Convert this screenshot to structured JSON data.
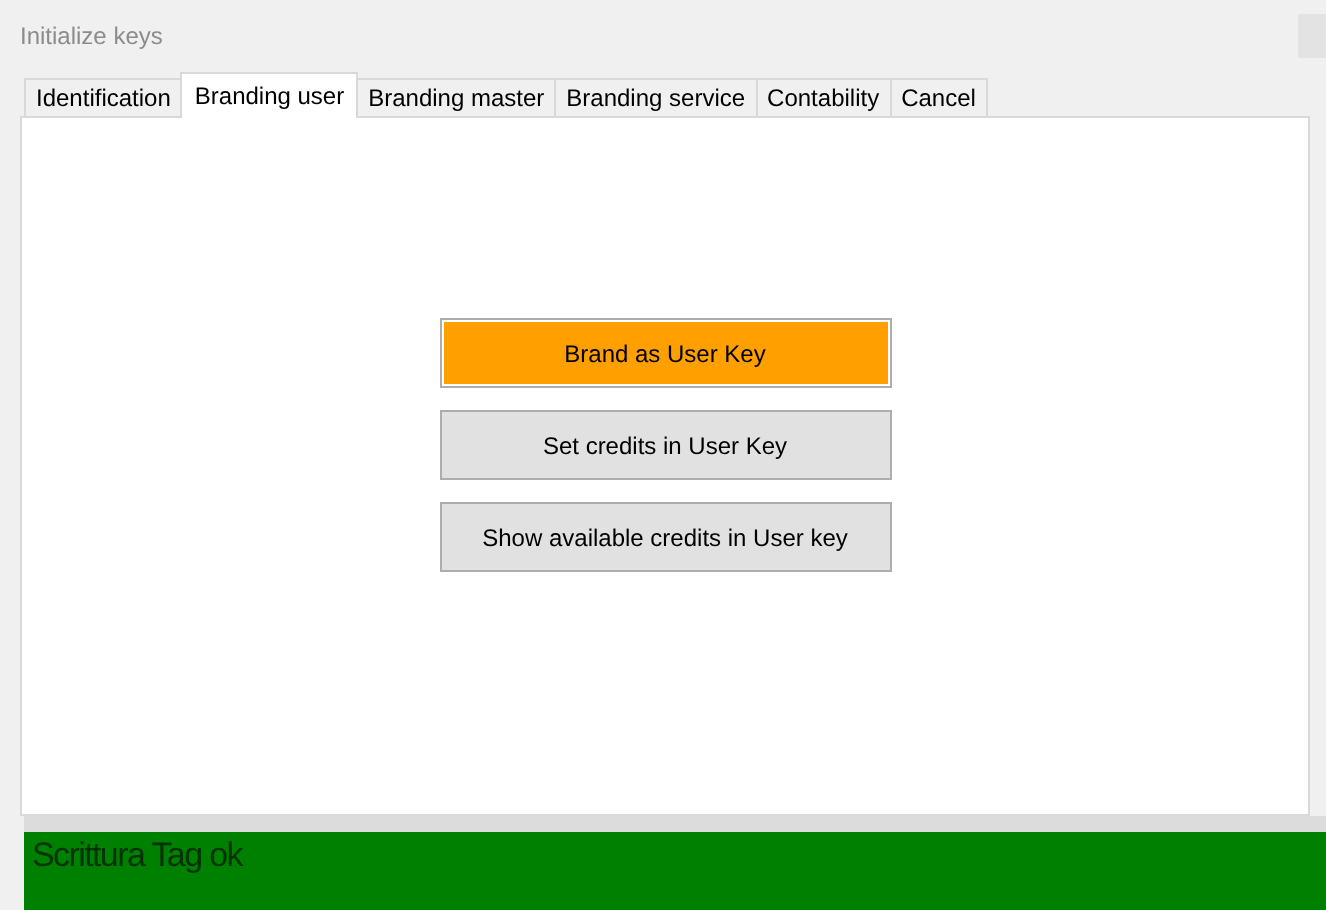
{
  "window": {
    "title": "Initialize keys"
  },
  "tabs": [
    {
      "label": "Identification",
      "selected": false
    },
    {
      "label": "Branding user",
      "selected": true
    },
    {
      "label": "Branding master",
      "selected": false
    },
    {
      "label": "Branding service",
      "selected": false
    },
    {
      "label": "Contability",
      "selected": false
    },
    {
      "label": "Cancel",
      "selected": false
    }
  ],
  "buttons": [
    {
      "label": "Brand as User Key",
      "highlighted": true
    },
    {
      "label": "Set credits in User Key",
      "highlighted": false
    },
    {
      "label": "Show available credits in User key",
      "highlighted": false
    }
  ],
  "status": {
    "text": "Scrittura Tag ok",
    "color": "#008000"
  }
}
